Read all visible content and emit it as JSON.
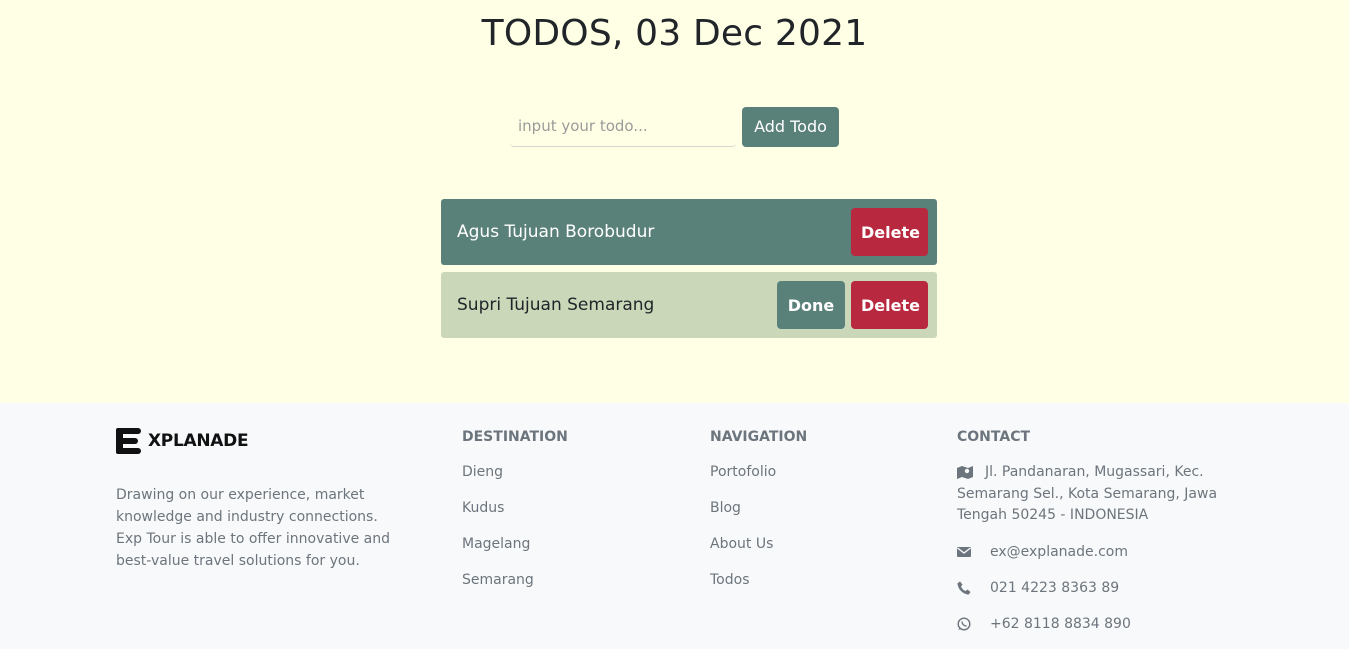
{
  "page": {
    "title": "TODOS, 03 Dec 2021"
  },
  "form": {
    "placeholder": "input your todo...",
    "add_label": "Add Todo"
  },
  "todos": [
    {
      "text": "Agus Tujuan Borobudur",
      "done": true,
      "done_label": "",
      "delete_label": "Delete"
    },
    {
      "text": "Supri Tujuan Semarang",
      "done": false,
      "done_label": "Done",
      "delete_label": "Delete"
    }
  ],
  "footer": {
    "brand": "XPLANADE",
    "about": "Drawing on our experience, market knowledge and industry connections. Exp Tour is able to offer innovative and best-value travel solutions for you.",
    "destination": {
      "title": "DESTINATION",
      "items": [
        "Dieng",
        "Kudus",
        "Magelang",
        "Semarang"
      ]
    },
    "navigation": {
      "title": "NAVIGATION",
      "items": [
        "Portofolio",
        "Blog",
        "About Us",
        "Todos"
      ]
    },
    "contact": {
      "title": "CONTACT",
      "address": "Jl. Pandanaran, Mugassari, Kec. Semarang Sel., Kota Semarang, Jawa Tengah 50245 - INDONESIA",
      "email": "ex@explanade.com",
      "phone": "021 4223 8363 89",
      "whatsapp": "+62 8118 8834 890"
    }
  },
  "colors": {
    "hero_bg": "#ffffe6",
    "primary": "#5a8179",
    "pending_bg": "#cad8b9",
    "danger": "#b8283e",
    "footer_bg": "#f8f9fa"
  }
}
